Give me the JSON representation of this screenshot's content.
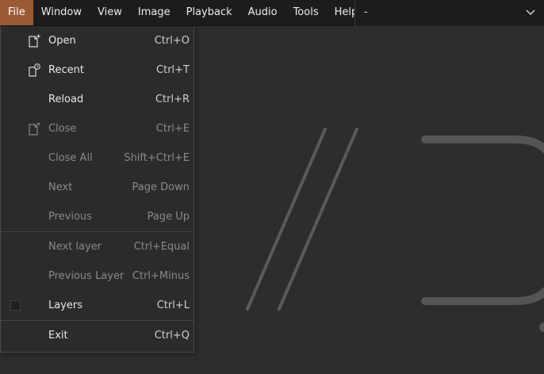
{
  "menubar": {
    "items": [
      {
        "label": "File",
        "active": true
      },
      {
        "label": "Window"
      },
      {
        "label": "View"
      },
      {
        "label": "Image"
      },
      {
        "label": "Playback"
      },
      {
        "label": "Audio"
      },
      {
        "label": "Tools"
      },
      {
        "label": "Help"
      }
    ]
  },
  "selector": {
    "value": "-",
    "icon": "chevron-down-icon"
  },
  "file_menu": {
    "items": [
      {
        "label": "Open",
        "shortcut": "Ctrl+O",
        "icon": "file-new-icon",
        "enabled": true
      },
      {
        "label": "Recent",
        "shortcut": "Ctrl+T",
        "icon": "file-recent-icon",
        "enabled": true
      },
      {
        "label": "Reload",
        "shortcut": "Ctrl+R",
        "enabled": true
      },
      {
        "label": "Close",
        "shortcut": "Ctrl+E",
        "icon": "file-close-icon",
        "enabled": false
      },
      {
        "label": "Close All",
        "shortcut": "Shift+Ctrl+E",
        "enabled": false
      },
      {
        "label": "Next",
        "shortcut": "Page Down",
        "enabled": false
      },
      {
        "label": "Previous",
        "shortcut": "Page Up",
        "enabled": false
      },
      {
        "label": "Next layer",
        "shortcut": "Ctrl+Equal",
        "enabled": false
      },
      {
        "label": "Previous Layer",
        "shortcut": "Ctrl+Minus",
        "enabled": false
      },
      {
        "label": "Layers",
        "shortcut": "Ctrl+L",
        "checkbox": true,
        "checked": false,
        "enabled": true
      },
      {
        "label": "Exit",
        "shortcut": "Ctrl+Q",
        "enabled": true
      }
    ]
  },
  "colors": {
    "accent": "#9a5a34",
    "background": "#2d2d2d",
    "menubar": "#1c1c1c",
    "logo_stroke": "#5a5a5a"
  }
}
